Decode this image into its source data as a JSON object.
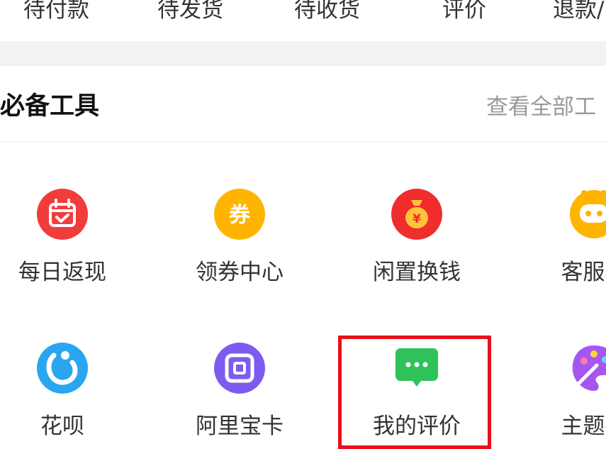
{
  "order_tabs": [
    "待付款",
    "待发货",
    "待收货",
    "评价",
    "退款/"
  ],
  "section": {
    "title": "必备工具",
    "view_all": "查看全部工"
  },
  "tools": [
    {
      "label": "每日返现",
      "icon": "calendar-check-icon",
      "color": "#f23c3c"
    },
    {
      "label": "领券中心",
      "icon": "coupon-icon",
      "color": "#ffb400",
      "glyph": "券"
    },
    {
      "label": "闲置换钱",
      "icon": "money-bag-icon",
      "color": "#f02d2d",
      "glyph": "¥"
    },
    {
      "label": "客服小",
      "icon": "service-robot-icon",
      "color": "#ffb400"
    },
    {
      "label": "花呗",
      "icon": "huabei-icon",
      "color": "#2aa6f0"
    },
    {
      "label": "阿里宝卡",
      "icon": "sim-card-icon",
      "color": "#7a5cf0"
    },
    {
      "label": "我的评价",
      "icon": "chat-bubble-icon",
      "color": "#2fc25b"
    },
    {
      "label": "主题抄",
      "icon": "theme-palette-icon",
      "color": "#a656f0"
    }
  ],
  "highlight_color": "#e8101a"
}
